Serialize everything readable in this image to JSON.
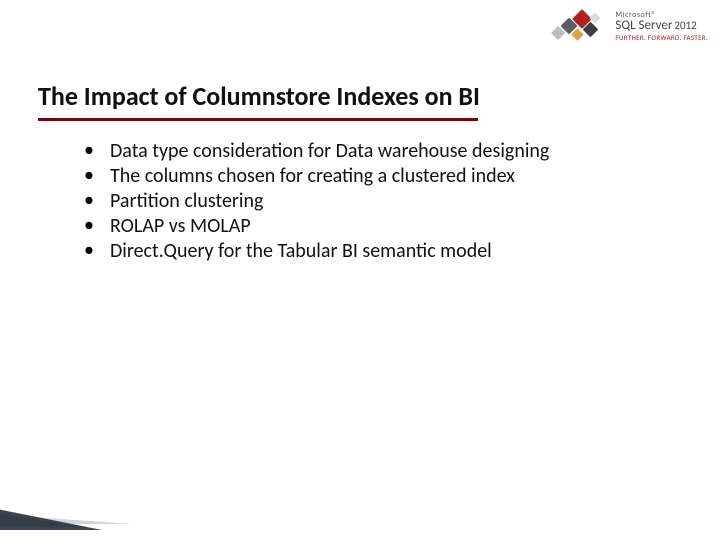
{
  "logo": {
    "vendor_small": "Microsoft®",
    "product": "SQL Server",
    "year": "2012",
    "tagline": "FURTHER. FORWARD. FASTER."
  },
  "title": "The Impact of Columnstore Indexes on BI",
  "bullets": [
    "Data type consideration for Data warehouse designing",
    "The columns chosen for creating a clustered index",
    "Partition clustering",
    "ROLAP vs MOLAP",
    "Direct.Query for the Tabular BI semantic model"
  ]
}
